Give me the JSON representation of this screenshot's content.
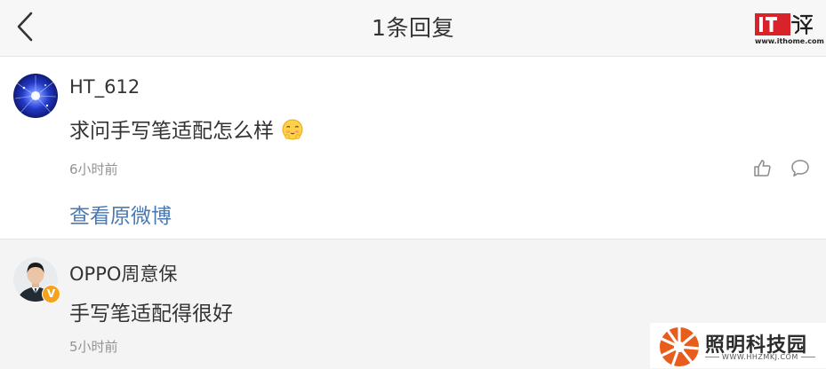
{
  "header": {
    "back_icon": "chevron-left-icon",
    "title": "1条回复"
  },
  "watermark_ithome": {
    "logo_text": "IT之家",
    "url": "www.ithome.com"
  },
  "comment": {
    "username": "HT_612",
    "text": "求问手写笔适配怎么样",
    "emoji": "shy-face-emoji",
    "time": "6小时前",
    "like_icon": "thumbs-up-icon",
    "reply_icon": "comment-bubble-icon",
    "view_original_label": "查看原微博"
  },
  "reply": {
    "username": "OPPO周意保",
    "verified_badge": "V",
    "text": "手写笔适配得很好",
    "time": "5小时前"
  },
  "watermark_brand": {
    "name": "照明科技园",
    "url": "WWW.HHZMKJ.COM"
  },
  "colors": {
    "link": "#4a7ab3",
    "time_gray": "#939393",
    "header_bg": "#f7f7f7",
    "reply_bg": "#f4f4f4",
    "badge_orange": "#f6a21d",
    "ithome_red": "#d8232a"
  }
}
